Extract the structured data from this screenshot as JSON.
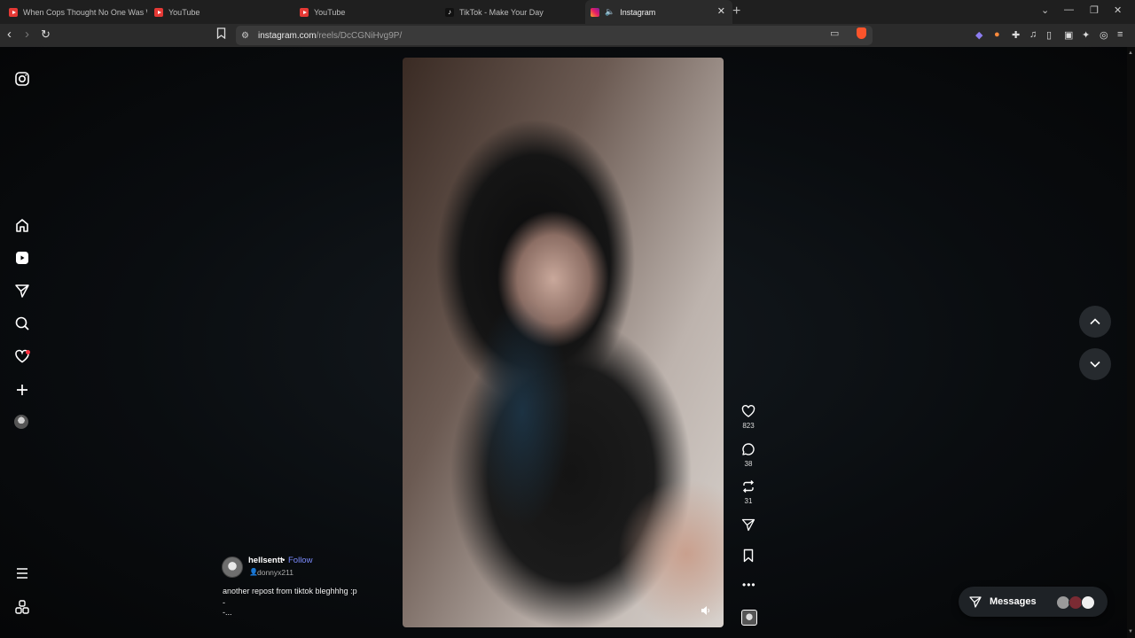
{
  "browser": {
    "tabs": [
      {
        "title": "When Cops Thought No One Was W",
        "favicon": "youtube-icon"
      },
      {
        "title": "YouTube",
        "favicon": "youtube-icon"
      },
      {
        "title": "YouTube",
        "favicon": "youtube-icon"
      },
      {
        "title": "TikTok - Make Your Day",
        "favicon": "tiktok-icon"
      },
      {
        "title": "Instagram",
        "favicon": "instagram-icon",
        "active": true,
        "playing_audio": true
      }
    ],
    "url_domain": "instagram.com",
    "url_path": "/reels/DcCGNiHvg9P/"
  },
  "reel": {
    "username": "hellsentt",
    "separator": "•",
    "follow_label": "Follow",
    "audio": "donnyx211",
    "caption": "another repost from tiktok bleghhhg :p",
    "caption_line2": "-",
    "caption_line3": "-...",
    "likes": "823",
    "comments": "38",
    "reposts": "31"
  },
  "messages": {
    "label": "Messages"
  },
  "colors": {
    "follow": "#7c8cff",
    "notification": "#ff3040",
    "brave": "#fb542b"
  }
}
